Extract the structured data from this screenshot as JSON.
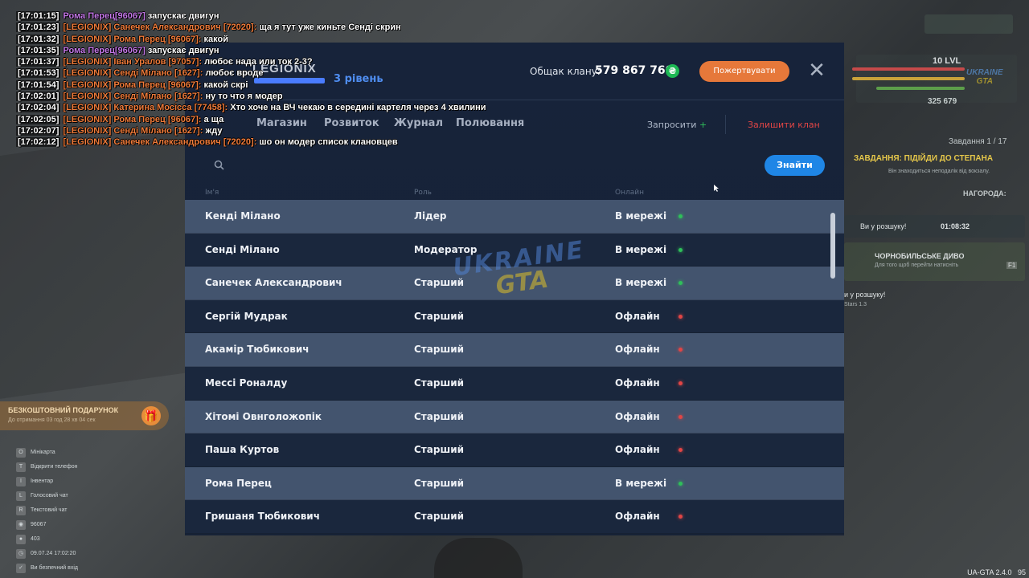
{
  "chat": [
    {
      "time": "[17:01:15]",
      "nick": "Рома Перец[96067]",
      "nick_color": "purple",
      "msg": "запускає двигун"
    },
    {
      "time": "[17:01:23]",
      "nick": "[LEGIONIX] Санечек Александрович [72020]:",
      "nick_color": "orange",
      "msg": "ща я тут уже киньте Сенді скрин"
    },
    {
      "time": "[17:01:32]",
      "nick": "[LEGIONIX] Рома Перец [96067]:",
      "nick_color": "orange",
      "msg": "какой"
    },
    {
      "time": "[17:01:35]",
      "nick": "Рома Перец[96067]",
      "nick_color": "purple",
      "msg": "запускає двигун"
    },
    {
      "time": "[17:01:37]",
      "nick": "[LEGIONIX] Іван Уралов [97057]:",
      "nick_color": "orange",
      "msg": "любоє нада или ток 2-3?"
    },
    {
      "time": "[17:01:53]",
      "nick": "[LEGIONIX] Сенді Мілано [1627]:",
      "nick_color": "orange",
      "msg": "любоє вроде"
    },
    {
      "time": "[17:01:54]",
      "nick": "[LEGIONIX] Рома Перец [96067]:",
      "nick_color": "orange",
      "msg": "какой скрі"
    },
    {
      "time": "[17:02:01]",
      "nick": "[LEGIONIX] Сенді Мілано [1627]:",
      "nick_color": "orange",
      "msg": "ну то что я модер"
    },
    {
      "time": "[17:02:04]",
      "nick": "[LEGIONIX] Катерина Мосісса [77458]:",
      "nick_color": "orange",
      "msg": "Хто хоче на ВЧ чекаю в  середині картеля через 4 хвилини"
    },
    {
      "time": "[17:02:05]",
      "nick": "[LEGIONIX] Рома Перец [96067]:",
      "nick_color": "orange",
      "msg": "а ща"
    },
    {
      "time": "[17:02:07]",
      "nick": "[LEGIONIX] Сенді Мілано [1627]:",
      "nick_color": "orange",
      "msg": "жду"
    },
    {
      "time": "[17:02:12]",
      "nick": "[LEGIONIX] Санечек Александрович [72020]:",
      "nick_color": "orange",
      "msg": "шо он модер   список клановцев"
    }
  ],
  "clan": {
    "name": "LEGIONIX",
    "level": "3 рівень",
    "treasury_label": "Общак клану:",
    "treasury_value": "579 867 760",
    "currency_symbol": "₴",
    "donate_label": "Пожертвувати",
    "close_symbol": "✕"
  },
  "nav": {
    "tabs": [
      "Магазин",
      "Розвиток",
      "Журнал",
      "Полювання"
    ],
    "invite_label": "Запросити",
    "invite_plus": "+",
    "leave_label": "Залишити клан"
  },
  "search": {
    "placeholder": "",
    "button_label": "Знайти"
  },
  "table": {
    "columns": [
      "Ім'я",
      "Роль",
      "Онлайн"
    ],
    "rows": [
      {
        "name": "Кенді Мілано",
        "role": "Лідер",
        "status": "В мережі",
        "online": true
      },
      {
        "name": "Сенді Мілано",
        "role": "Модератор",
        "status": "В мережі",
        "online": true
      },
      {
        "name": "Санечек Александрович",
        "role": "Старший",
        "status": "В мережі",
        "online": true
      },
      {
        "name": "Сергій Мудрак",
        "role": "Старший",
        "status": "Офлайн",
        "online": false
      },
      {
        "name": "Акамір Тюбикович",
        "role": "Старший",
        "status": "Офлайн",
        "online": false
      },
      {
        "name": "Мессі Роналду",
        "role": "Старший",
        "status": "Офлайн",
        "online": false
      },
      {
        "name": "Хітомі Овнголожопік",
        "role": "Старший",
        "status": "Офлайн",
        "online": false
      },
      {
        "name": "Паша Куртов",
        "role": "Старший",
        "status": "Офлайн",
        "online": false
      },
      {
        "name": "Рома Перец",
        "role": "Старший",
        "status": "В мережі",
        "online": true
      },
      {
        "name": "Гришаня Тюбикович",
        "role": "Старший",
        "status": "Офлайн",
        "online": false
      }
    ]
  },
  "colors": {
    "online_dot": "#2fbf5a",
    "offline_dot": "#e14545",
    "accent_blue": "#1f86e6",
    "donate_orange": "#e6783a"
  },
  "hud": {
    "level": "10 LVL",
    "money": "325 679",
    "task_counter": "Завдання 1 / 17",
    "task_title": "ЗАВДАННЯ: ПІДІЙДИ ДО СТЕПАНА",
    "task_sub": "Він знаходиться неподалік від вокзалу.",
    "reward_label": "НАГОРОДА:",
    "wanted_label": "Ви у розшуку!",
    "wanted_timer": "01:08:32",
    "event_title": "ЧОРНОБИЛЬСЬКЕ ДИВО",
    "event_sub": "Для того щоб перейти натисніть",
    "event_key": "F1",
    "wanted_label2": "и у розшуку!",
    "stars_label": "Stars 1.3",
    "logo_line1": "UKRAINE",
    "logo_line2": "GTA"
  },
  "left_panel": {
    "gift_title": "БЕЗКОШТОВНИЙ ПОДАРУНОК",
    "gift_sub": "До отримання 03 год 28 хв 04 сек",
    "menu": [
      {
        "key": "O",
        "label": "Мінікарта"
      },
      {
        "key": "T",
        "label": "Відкрити телефон"
      },
      {
        "key": "I",
        "label": "Інвентар"
      },
      {
        "key": "L",
        "label": "Голосовий чат"
      },
      {
        "key": "R",
        "label": "Текстовий чат"
      }
    ],
    "id": "96067",
    "online": "403",
    "datetime": "09.07.24 17:02:20",
    "footer_note": "Ви безпечний вхід"
  },
  "watermark": {
    "line1": "UKRAINE",
    "line2": "GTA"
  },
  "version": "UA-GTA 2.4.0",
  "fps": "95"
}
